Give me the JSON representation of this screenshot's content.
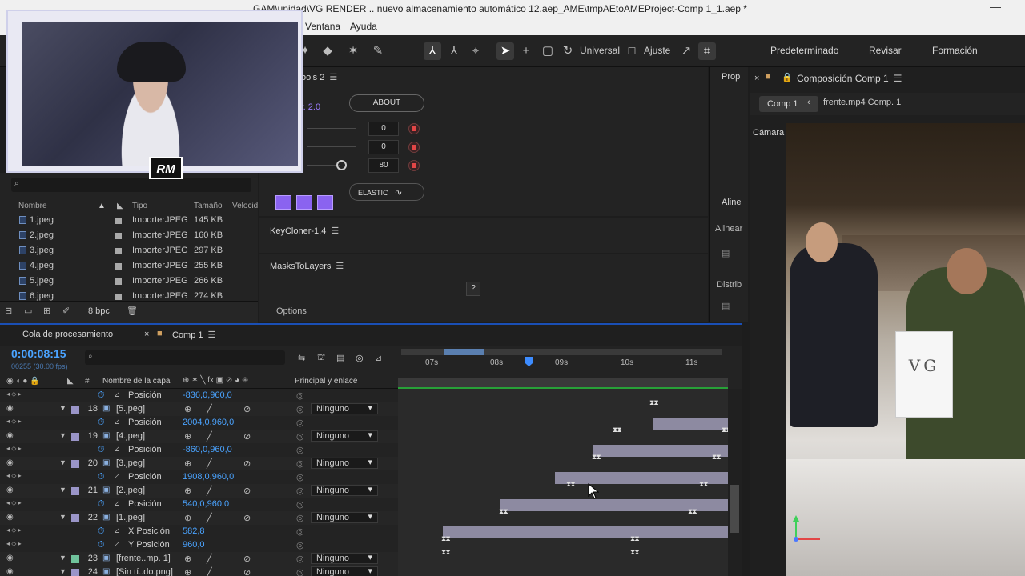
{
  "titlebar": {
    "title": "GAM\\unidad\\VG RENDER .. nuevo almacenamiento automático 12.aep_AME\\tmpAEtoAMEProject-Comp 1_1.aep *"
  },
  "menu": {
    "items": [
      "Ventana",
      "Ayuda"
    ]
  },
  "toolbar": {
    "universal_label": "Universal",
    "ajuste_label": "Ajuste",
    "workspaces": [
      "Predeterminado",
      "Revisar",
      "Formación"
    ]
  },
  "webcam": {
    "logo_text": "RM"
  },
  "project": {
    "columns": {
      "name": "Nombre",
      "type": "Tipo",
      "size": "Tamaño",
      "speed": "Velocid"
    },
    "items": [
      {
        "name": "1.jpeg",
        "type": "ImporterJPEG",
        "size": "145 KB"
      },
      {
        "name": "2.jpeg",
        "type": "ImporterJPEG",
        "size": "160 KB"
      },
      {
        "name": "3.jpeg",
        "type": "ImporterJPEG",
        "size": "297 KB"
      },
      {
        "name": "4.jpeg",
        "type": "ImporterJPEG",
        "size": "255 KB"
      },
      {
        "name": "5.jpeg",
        "type": "ImporterJPEG",
        "size": "266 KB"
      },
      {
        "name": "6.jpeg",
        "type": "ImporterJPEG",
        "size": "274 KB"
      }
    ],
    "bpc": "8 bpc"
  },
  "tools2": {
    "title": "ools 2",
    "version": "v. 2.0",
    "about": "ABOUT",
    "fields": [
      "0",
      "0",
      "80"
    ],
    "elastic": "ELASTIC"
  },
  "keycloner": {
    "title": "KeyCloner-1.4"
  },
  "maskstolayers": {
    "title": "MasksToLayers",
    "help": "?",
    "options": "Options"
  },
  "sidepanel": {
    "prop": "Prop",
    "aline": "Aline",
    "alinear": "Alinear",
    "distrib": "Distrib"
  },
  "viewer": {
    "panel_title": "Composición Comp 1",
    "tab_active": "Comp 1",
    "tab_other": "frente.mp4 Comp. 1",
    "camera": "Cámara activa (predeterminada)",
    "card_text": "VG",
    "gizmo_z": "Z"
  },
  "timeline": {
    "tab_render": "Cola de procesamiento",
    "tab_comp": "Comp 1",
    "timecode": "0:00:08:15",
    "fps": "00255 (30.00 fps)",
    "col_layer": "Nombre de la capa",
    "col_parent": "Principal y enlace",
    "ticks": [
      "07s",
      "08s",
      "09s",
      "10s",
      "11s"
    ],
    "rows": [
      {
        "kind": "prop",
        "prop": "Posición",
        "value": "-836,0,960,0"
      },
      {
        "kind": "layer",
        "num": "18",
        "name": "[5.jpeg]",
        "parent": "Ninguno",
        "color": "#9a95c8"
      },
      {
        "kind": "prop",
        "prop": "Posición",
        "value": "2004,0,960,0"
      },
      {
        "kind": "layer",
        "num": "19",
        "name": "[4.jpeg]",
        "parent": "Ninguno",
        "color": "#9a95c8"
      },
      {
        "kind": "prop",
        "prop": "Posición",
        "value": "-860,0,960,0"
      },
      {
        "kind": "layer",
        "num": "20",
        "name": "[3.jpeg]",
        "parent": "Ninguno",
        "color": "#9a95c8"
      },
      {
        "kind": "prop",
        "prop": "Posición",
        "value": "1908,0,960,0"
      },
      {
        "kind": "layer",
        "num": "21",
        "name": "[2.jpeg]",
        "parent": "Ninguno",
        "color": "#9a95c8"
      },
      {
        "kind": "prop",
        "prop": "Posición",
        "value": "540,0,960,0"
      },
      {
        "kind": "layer",
        "num": "22",
        "name": "[1.jpeg]",
        "parent": "Ninguno",
        "color": "#9a95c8"
      },
      {
        "kind": "prop",
        "prop": "X Posición",
        "value": "582,8"
      },
      {
        "kind": "prop",
        "prop": "Y Posición",
        "value": "960,0"
      },
      {
        "kind": "layer",
        "num": "23",
        "name": "[frente..mp. 1]",
        "parent": "Ninguno",
        "color": "#6fc29c"
      },
      {
        "kind": "layer",
        "num": "24",
        "name": "[Sin tí..do.png]",
        "parent": "Ninguno",
        "color": "#9a95c8"
      }
    ]
  }
}
